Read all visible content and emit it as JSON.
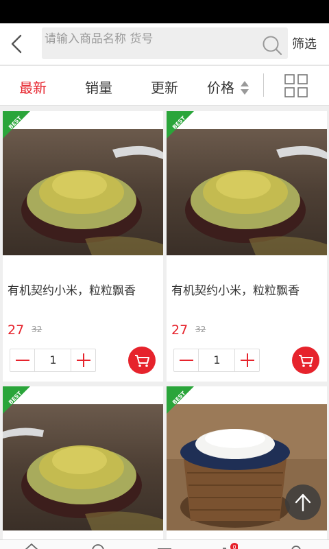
{
  "header": {
    "search_placeholder": "请输入商品名称 货号",
    "filter_label": "筛选"
  },
  "sort_tabs": [
    "最新",
    "销量",
    "更新",
    "价格"
  ],
  "ribbon_label": "BEST",
  "products": [
    {
      "title": "有机契约小米，粒粒飘香",
      "price": "27",
      "old_price": "32",
      "quantity": "1",
      "image": "millet-bowl"
    },
    {
      "title": "有机契约小米，粒粒飘香",
      "price": "27",
      "old_price": "32",
      "quantity": "1",
      "image": "millet-bowl"
    },
    {
      "image": "millet-bowl"
    },
    {
      "image": "rice-basket"
    }
  ],
  "bottom_nav": {
    "items": [
      "home-icon",
      "location-icon",
      "category-icon",
      "cart-icon",
      "user-icon"
    ],
    "cart_badge": "0"
  },
  "colors": {
    "accent": "#e6232c",
    "ribbon": "#2aa53a"
  }
}
